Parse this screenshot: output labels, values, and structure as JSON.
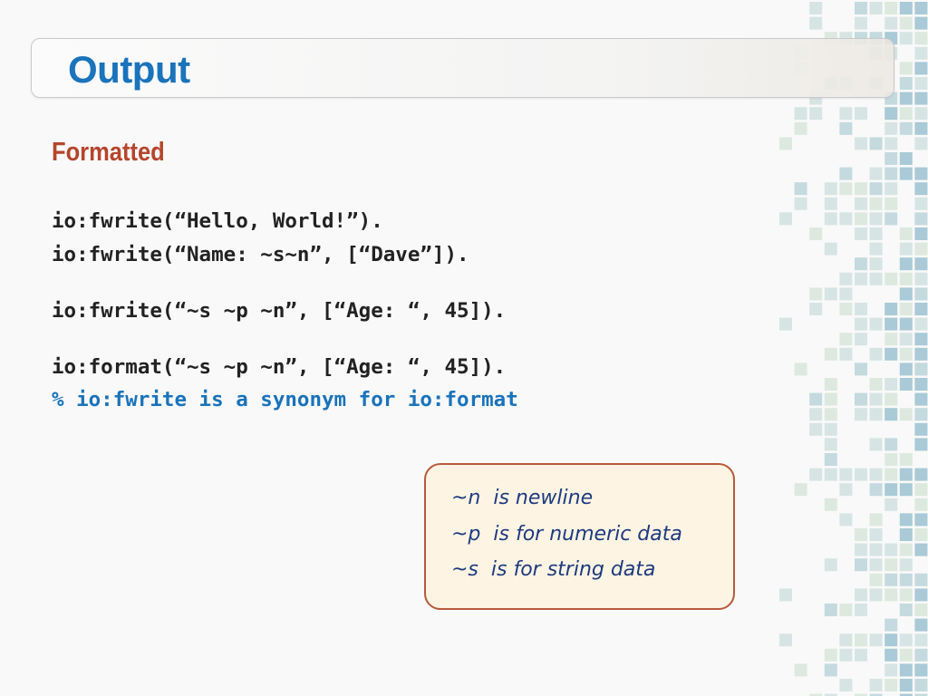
{
  "slide": {
    "title": "Output",
    "subtitle": "Formatted",
    "code_lines": [
      "io:fwrite(“Hello, World!”).",
      "io:fwrite(“Name: ~s~n”, [“Dave”]).",
      "io:fwrite(“~s ~p ~n”, [“Age: “, 45]).",
      "io:format(“~s ~p ~n”, [“Age: “, 45]).",
      "% io:fwrite is a synonym for io:format"
    ],
    "notes": [
      "~n  is newline",
      "~p  is for numeric data",
      "~s  is for string data"
    ]
  },
  "colors": {
    "title": "#1a73bb",
    "subtitle": "#b5452c",
    "code": "#222222",
    "comment": "#1a73bb",
    "note_text": "#1f3a80",
    "note_border": "#b9593b",
    "note_bg": "#fdf4e3"
  }
}
